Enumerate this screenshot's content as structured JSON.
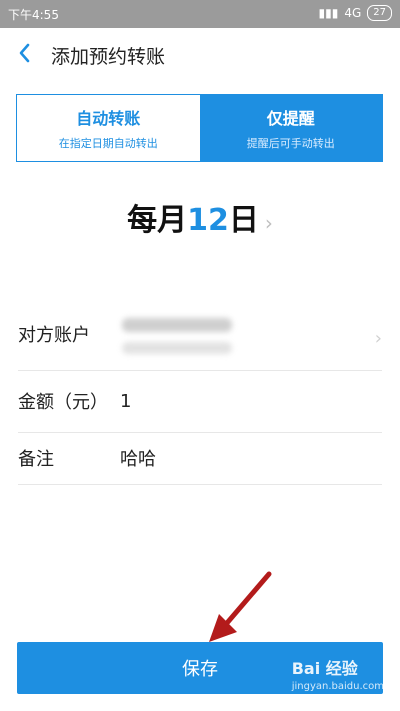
{
  "status_bar": {
    "time": "下午4:55",
    "network": "4G",
    "battery": "27"
  },
  "header": {
    "title": "添加预约转账"
  },
  "tabs": [
    {
      "title": "自动转账",
      "subtitle": "在指定日期自动转出"
    },
    {
      "title": "仅提醒",
      "subtitle": "提醒后可手动转出"
    }
  ],
  "schedule": {
    "prefix": "每月",
    "day": "12",
    "suffix": "日"
  },
  "form": {
    "account_label": "对方账户",
    "amount_label": "金额（元）",
    "amount_value": "1",
    "note_label": "备注",
    "note_value": "哈哈"
  },
  "actions": {
    "save_label": "保存"
  },
  "watermark": {
    "brand": "Bai 经验",
    "domain": "jingyan.baidu.com"
  },
  "colors": {
    "accent": "#1e8fe1",
    "status_bar": "#9b9b9b",
    "arrow": "#b31b1b"
  },
  "icons": {
    "back": "back-chevron-icon",
    "schedule_next": "chevron-right-icon",
    "account_next": "chevron-right-icon",
    "annotation": "red-arrow-icon"
  }
}
